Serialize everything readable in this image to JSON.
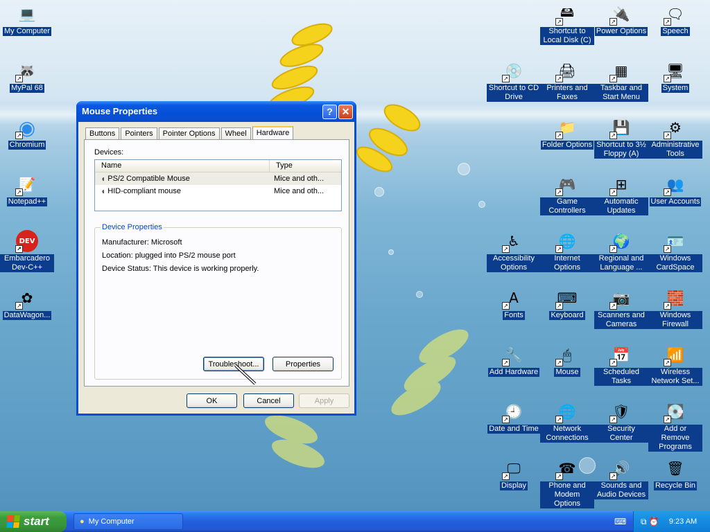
{
  "desktop_left": [
    {
      "label": "My Computer",
      "glyph": "💻",
      "shortcut": false
    },
    {
      "label": "MyPal 68",
      "glyph": "🦝",
      "shortcut": true
    },
    {
      "label": "Chromium",
      "glyph": "◉",
      "shortcut": true
    },
    {
      "label": "Notepad++",
      "glyph": "📝",
      "shortcut": true
    },
    {
      "label": "Embarcadero Dev-C++",
      "glyph": "DEV",
      "shortcut": true
    },
    {
      "label": "DataWagon...",
      "glyph": "✿",
      "shortcut": true
    }
  ],
  "desktop_right": [
    {
      "label": "Shortcut to Local Disk (C)",
      "glyph": "🖴",
      "shortcut": true
    },
    {
      "label": "Power Options",
      "glyph": "🔌",
      "shortcut": true
    },
    {
      "label": "Speech",
      "glyph": "🗨",
      "shortcut": true
    },
    {
      "label": "Shortcut to CD Drive",
      "glyph": "💿",
      "shortcut": true
    },
    {
      "label": "Printers and Faxes",
      "glyph": "🖨",
      "shortcut": true
    },
    {
      "label": "Taskbar and Start Menu",
      "glyph": "▦",
      "shortcut": true
    },
    {
      "label": "System",
      "glyph": "🖥",
      "shortcut": true
    },
    {
      "label": "Folder Options",
      "glyph": "📁",
      "shortcut": true
    },
    {
      "label": "Shortcut to 3½ Floppy (A)",
      "glyph": "💾",
      "shortcut": true
    },
    {
      "label": "Administrative Tools",
      "glyph": "⚙",
      "shortcut": true
    },
    {
      "label": "Game Controllers",
      "glyph": "🎮",
      "shortcut": true
    },
    {
      "label": "Automatic Updates",
      "glyph": "⊞",
      "shortcut": true
    },
    {
      "label": "User Accounts",
      "glyph": "👥",
      "shortcut": true
    },
    {
      "label": "Accessibility Options",
      "glyph": "♿",
      "shortcut": true
    },
    {
      "label": "Internet Options",
      "glyph": "🌐",
      "shortcut": true
    },
    {
      "label": "Regional and Language ...",
      "glyph": "🌍",
      "shortcut": true
    },
    {
      "label": "Windows CardSpace",
      "glyph": "🪪",
      "shortcut": true
    },
    {
      "label": "Fonts",
      "glyph": "A",
      "shortcut": true
    },
    {
      "label": "Keyboard",
      "glyph": "⌨",
      "shortcut": true
    },
    {
      "label": "Scanners and Cameras",
      "glyph": "📷",
      "shortcut": true
    },
    {
      "label": "Windows Firewall",
      "glyph": "🧱",
      "shortcut": true
    },
    {
      "label": "Add Hardware",
      "glyph": "🔧",
      "shortcut": true
    },
    {
      "label": "Mouse",
      "glyph": "🖱",
      "shortcut": true
    },
    {
      "label": "Scheduled Tasks",
      "glyph": "📅",
      "shortcut": true
    },
    {
      "label": "Wireless Network Set...",
      "glyph": "📶",
      "shortcut": true
    },
    {
      "label": "Date and Time",
      "glyph": "🕘",
      "shortcut": true
    },
    {
      "label": "Network Connections",
      "glyph": "🌐",
      "shortcut": true
    },
    {
      "label": "Security Center",
      "glyph": "🛡",
      "shortcut": true
    },
    {
      "label": "Add or Remove Programs",
      "glyph": "💽",
      "shortcut": true
    },
    {
      "label": "Display",
      "glyph": "🖵",
      "shortcut": true
    },
    {
      "label": "Phone and Modem Options",
      "glyph": "☎",
      "shortcut": true
    },
    {
      "label": "Sounds and Audio Devices",
      "glyph": "🔊",
      "shortcut": true
    },
    {
      "label": "Recycle Bin",
      "glyph": "🗑",
      "shortcut": false
    }
  ],
  "dialog": {
    "title": "Mouse Properties",
    "help_glyph": "?",
    "close_glyph": "✕",
    "tabs": [
      "Buttons",
      "Pointers",
      "Pointer Options",
      "Wheel",
      "Hardware"
    ],
    "active_tab": "Hardware",
    "devices_label": "Devices:",
    "columns": [
      "Name",
      "Type"
    ],
    "devices": [
      {
        "name": "PS/2 Compatible Mouse",
        "type": "Mice and oth...",
        "selected": true
      },
      {
        "name": "HID-compliant mouse",
        "type": "Mice and oth...",
        "selected": false
      }
    ],
    "device_properties_title": "Device Properties",
    "manufacturer": "Manufacturer: Microsoft",
    "location": "Location: plugged into PS/2 mouse port",
    "status": "Device Status: This device is working properly.",
    "troubleshoot_label": "Troubleshoot...",
    "properties_label": "Properties",
    "ok_label": "OK",
    "cancel_label": "Cancel",
    "apply_label": "Apply"
  },
  "taskbar": {
    "start_label": "start",
    "task_label": "My Computer",
    "clock": "9:23 AM"
  },
  "colors": {
    "desktop_label_bg": "#0b3d8c",
    "titlebar": "#0a58e0",
    "taskbar": "#245edc",
    "start": "#3c9d3c",
    "tray": "#148be0"
  }
}
